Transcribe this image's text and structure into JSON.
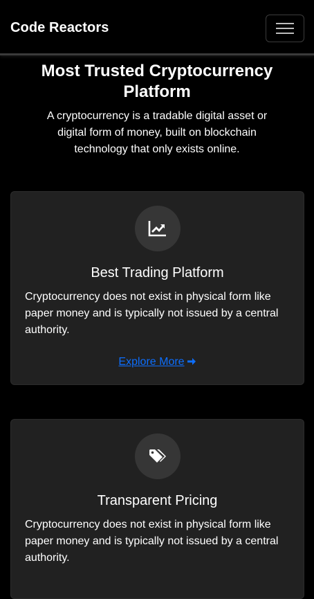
{
  "navbar": {
    "brand": "Code Reactors",
    "toggler_icon": "hamburger-menu-icon"
  },
  "hero": {
    "title": "Most Trusted Cryptocurrency Platform",
    "description": "A cryptocurrency is a tradable digital asset or digital form of money, built on blockchain technology that only exists online."
  },
  "cards": [
    {
      "icon": "chart-line-icon",
      "title": "Best Trading Platform",
      "text": "Cryptocurrency does not exist in physical form like paper money and is typically not issued by a central authority.",
      "link_label": "Explore More"
    },
    {
      "icon": "tags-icon",
      "title": "Transparent Pricing",
      "text": "Cryptocurrency does not exist in physical form like paper money and is typically not issued by a central authority."
    }
  ],
  "colors": {
    "background": "#000000",
    "card": "#212121",
    "icon_circle": "#363636",
    "link": "#0d6efd"
  }
}
